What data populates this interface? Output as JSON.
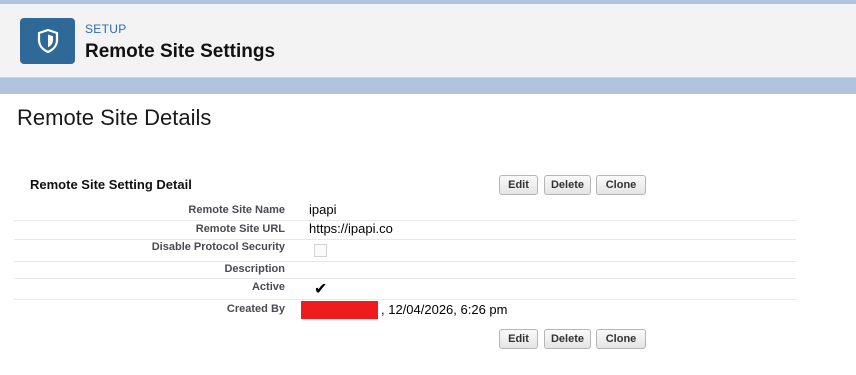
{
  "header": {
    "eyebrow": "SETUP",
    "title": "Remote Site Settings",
    "icon": "shield-icon",
    "accent": "#2f6997"
  },
  "main": {
    "section_title": "Remote Site Details",
    "detail_heading": "Remote Site Setting Detail",
    "buttons": {
      "edit": "Edit",
      "delete": "Delete",
      "clone": "Clone"
    },
    "fields": {
      "remote_site_name": {
        "label": "Remote Site Name",
        "value": "ipapi"
      },
      "remote_site_url": {
        "label": "Remote Site URL",
        "value": "https://ipapi.co"
      },
      "disable_protocol_security": {
        "label": "Disable Protocol Security",
        "checked": false
      },
      "description": {
        "label": "Description",
        "value": ""
      },
      "active": {
        "label": "Active",
        "checked": true
      },
      "created_by": {
        "label": "Created By",
        "value": ", 12/04/2026, 6:26 pm",
        "redacted": true
      }
    }
  }
}
